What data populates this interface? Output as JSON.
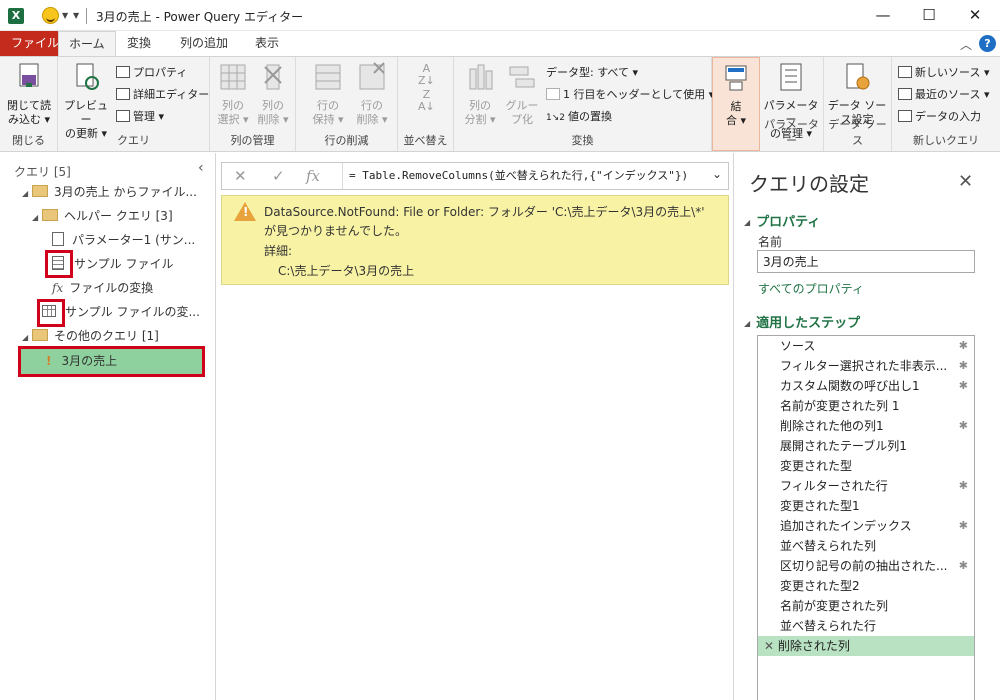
{
  "titlebar": {
    "title": "3月の売上 - Power Query エディター",
    "minimize": "—",
    "maximize": "☐",
    "close": "✕"
  },
  "tabs": [
    {
      "label": "ファイル"
    },
    {
      "label": "ホーム"
    },
    {
      "label": "変換"
    },
    {
      "label": "列の追加"
    },
    {
      "label": "表示"
    }
  ],
  "ribbon": {
    "close_group": {
      "button_line1": "閉じて読",
      "button_line2": "み込む ▾",
      "label": "閉じる"
    },
    "query_group": {
      "preview_line1": "プレビュー",
      "preview_line2": "の更新 ▾",
      "properties": "プロパティ",
      "advanced_editor": "詳細エディター",
      "manage": "管理 ▾",
      "label": "クエリ"
    },
    "columns_group": {
      "choose_line1": "列の",
      "choose_line2": "選択 ▾",
      "remove_line1": "列の",
      "remove_line2": "削除 ▾",
      "label": "列の管理"
    },
    "rows_group": {
      "keep_line1": "行の",
      "keep_line2": "保持 ▾",
      "remove_line1": "行の",
      "remove_line2": "削除 ▾",
      "label": "行の削減"
    },
    "sort_group": {
      "label": "並べ替え"
    },
    "transform_group": {
      "split_line1": "列の",
      "split_line2": "分割 ▾",
      "group_line1": "グルー",
      "group_line2": "プ化",
      "data_type": "データ型: すべて ▾",
      "first_row_header": "1 行目をヘッダーとして使用 ▾",
      "replace_values": "値の置換",
      "label": "変換"
    },
    "combine_group": {
      "line1": "結",
      "line2": "合 ▾"
    },
    "params_group": {
      "line1": "パラメーター",
      "line2": "の管理 ▾",
      "label": "パラメーター"
    },
    "datasource_group": {
      "line1": "データ ソー",
      "line2": "ス設定",
      "label": "データ ソース"
    },
    "newquery_group": {
      "new_source": "新しいソース ▾",
      "recent_sources": "最近のソース ▾",
      "enter_data": "データの入力",
      "label": "新しいクエリ"
    }
  },
  "queries": {
    "header": "クエリ [5]",
    "items": [
      {
        "label": "3月の売上 からファイル..."
      },
      {
        "label": "ヘルパー クエリ [3]"
      },
      {
        "label": "パラメーター1 (サン..."
      },
      {
        "label": "サンプル ファイル"
      },
      {
        "label": "ファイルの変換"
      },
      {
        "label": "サンプル ファイルの変..."
      },
      {
        "label": "その他のクエリ [1]"
      },
      {
        "label": "3月の売上"
      }
    ]
  },
  "formula": {
    "text": "= Table.RemoveColumns(並べ替えられた行,{\"インデックス\"})"
  },
  "error": {
    "message": "DataSource.NotFound: File or Folder: フォルダー 'C:\\売上データ\\3月の売上\\*' が見つかりませんでした。",
    "detail_label": "詳細:",
    "detail": "C:\\売上データ\\3月の売上"
  },
  "settings": {
    "title": "クエリの設定",
    "properties_header": "プロパティ",
    "name_label": "名前",
    "name_value": "3月の売上",
    "all_properties": "すべてのプロパティ",
    "steps_header": "適用したステップ",
    "steps": [
      {
        "label": "ソース",
        "gear": true
      },
      {
        "label": "フィルター選択された非表示...",
        "gear": true
      },
      {
        "label": "カスタム関数の呼び出し1",
        "gear": true
      },
      {
        "label": "名前が変更された列 1",
        "gear": false
      },
      {
        "label": "削除された他の列1",
        "gear": true
      },
      {
        "label": "展開されたテーブル列1",
        "gear": false
      },
      {
        "label": "変更された型",
        "gear": false
      },
      {
        "label": "フィルターされた行",
        "gear": true
      },
      {
        "label": "変更された型1",
        "gear": false
      },
      {
        "label": "追加されたインデックス",
        "gear": true
      },
      {
        "label": "並べ替えられた列",
        "gear": false
      },
      {
        "label": "区切り記号の前の抽出された...",
        "gear": true
      },
      {
        "label": "変更された型2",
        "gear": false
      },
      {
        "label": "名前が変更された列",
        "gear": false
      },
      {
        "label": "並べ替えられた行",
        "gear": false
      },
      {
        "label": "削除された列",
        "gear": false
      }
    ]
  },
  "colors": {
    "accent": "#217346",
    "file_tab": "#c42b1c",
    "selected": "#8fd19e",
    "error_bg": "#f8f3a4",
    "highlight_box": "#d0021b"
  }
}
